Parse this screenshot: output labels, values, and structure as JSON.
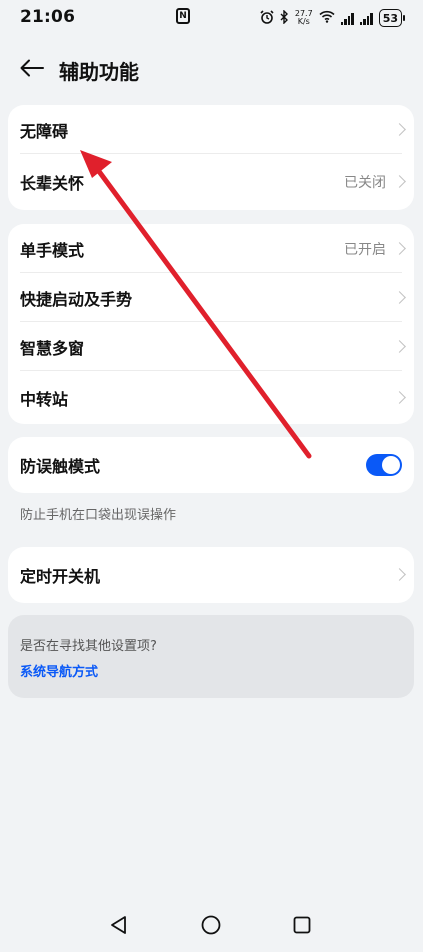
{
  "status_bar": {
    "time": "21:06",
    "nfc": "N",
    "net_speed_value": "27.7",
    "net_speed_unit": "K/s",
    "battery": "53"
  },
  "header": {
    "title": "辅助功能"
  },
  "group1": {
    "items": [
      {
        "label": "无障碍",
        "value": ""
      },
      {
        "label": "长辈关怀",
        "value": "已关闭"
      }
    ]
  },
  "group2": {
    "items": [
      {
        "label": "单手模式",
        "value": "已开启"
      },
      {
        "label": "快捷启动及手势",
        "value": ""
      },
      {
        "label": "智慧多窗",
        "value": ""
      },
      {
        "label": "中转站",
        "value": ""
      }
    ]
  },
  "group3": {
    "label": "防误触模式",
    "enabled": true,
    "hint": "防止手机在口袋出现误操作"
  },
  "group4": {
    "label": "定时开关机"
  },
  "suggestion": {
    "question": "是否在寻找其他设置项?",
    "link": "系统导航方式"
  },
  "colors": {
    "accent": "#0a59f7",
    "annotation_arrow": "#e0202c",
    "background": "#f1f3f5"
  },
  "icons": {
    "back": "arrow-left-icon",
    "chevron": "chevron-right-icon",
    "nav_back": "triangle-back-icon",
    "nav_home": "circle-home-icon",
    "nav_recent": "square-recent-icon"
  }
}
